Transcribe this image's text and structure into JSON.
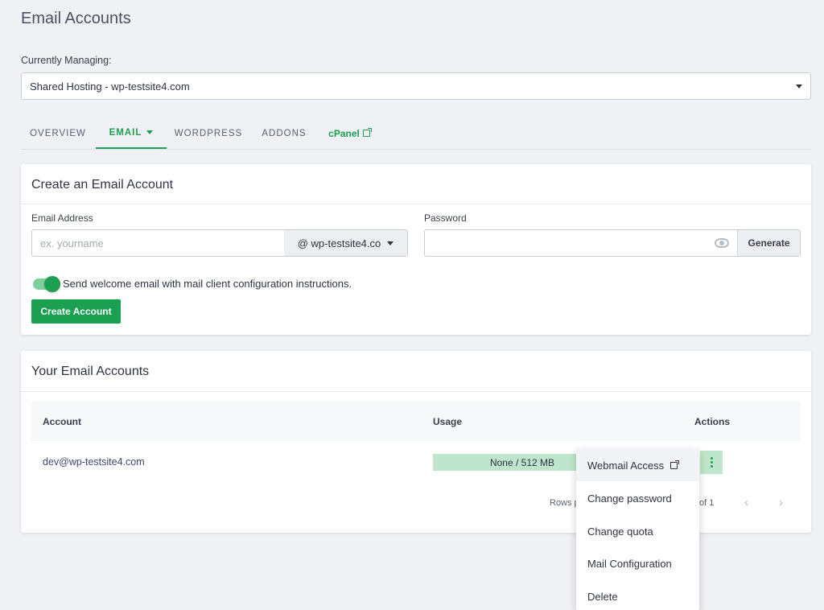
{
  "page": {
    "title": "Email Accounts"
  },
  "managing": {
    "label": "Currently Managing:",
    "selected": "Shared Hosting - wp-testsite4.com"
  },
  "tabs": [
    {
      "label": "OVERVIEW"
    },
    {
      "label": "EMAIL"
    },
    {
      "label": "WORDPRESS"
    },
    {
      "label": "ADDONS"
    },
    {
      "label": "cPanel"
    }
  ],
  "create": {
    "title": "Create an Email Account",
    "email_label": "Email Address",
    "email_placeholder": "ex. yourname",
    "domain": "@ wp-testsite4.co",
    "password_label": "Password",
    "generate_label": "Generate",
    "welcome_toggle_label": "Send welcome email with mail client configuration instructions.",
    "create_button": "Create Account"
  },
  "accounts": {
    "title": "Your Email Accounts",
    "columns": {
      "account": "Account",
      "usage": "Usage",
      "actions": "Actions"
    },
    "rows": [
      {
        "email": "dev@wp-testsite4.com",
        "usage": "None / 512 MB"
      }
    ],
    "rows_label": "Rows p",
    "pager_info": "of 1"
  },
  "actions_menu": {
    "items": [
      "Webmail Access",
      "Change password",
      "Change quota",
      "Mail Configuration",
      "Delete"
    ]
  },
  "colors": {
    "accent": "#1aa050",
    "usage_fill": "#bfe6cd"
  },
  "icons": [
    "chevron-down-icon",
    "external-link-icon",
    "eye-icon",
    "more-vert-icon",
    "chevron-left-icon",
    "chevron-right-icon"
  ]
}
